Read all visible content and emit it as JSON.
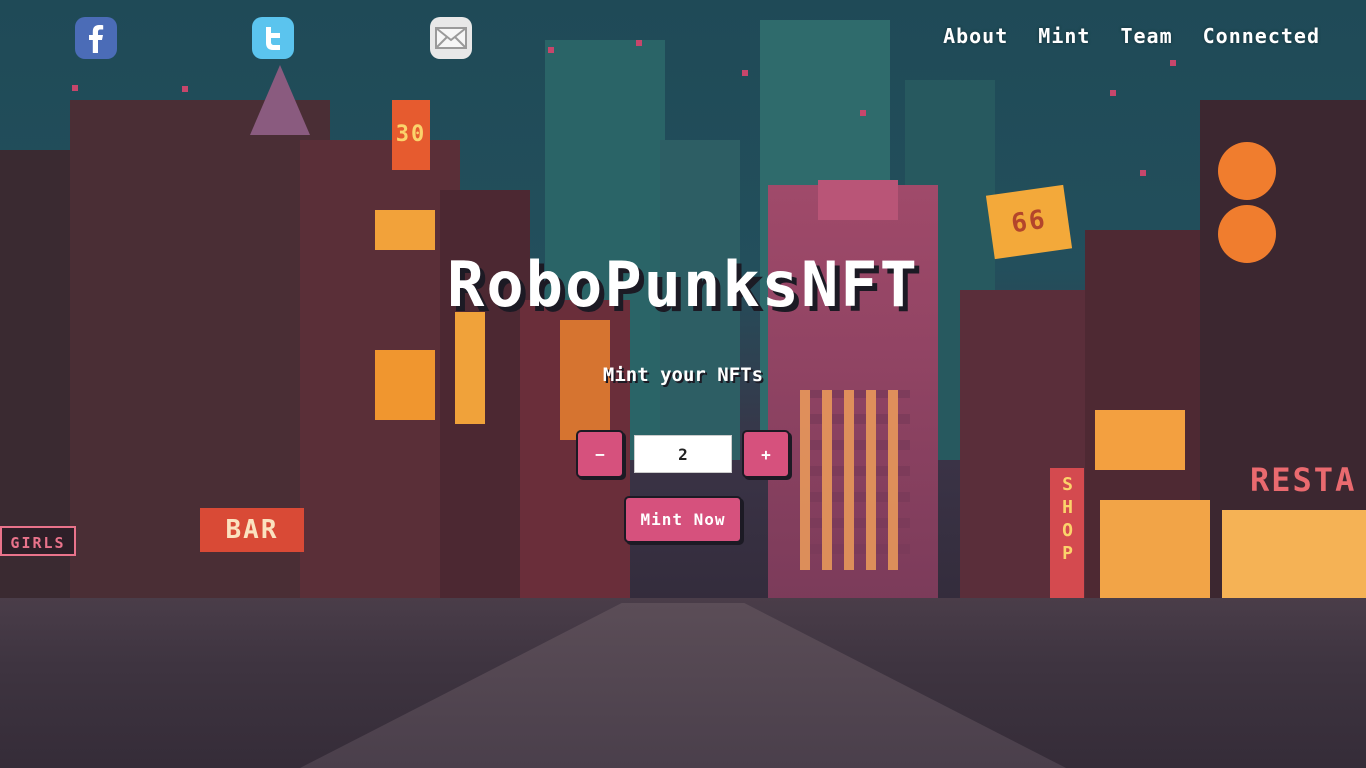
{
  "header": {
    "social": [
      {
        "name": "facebook",
        "icon": "facebook-icon",
        "color": "#4b6cb7"
      },
      {
        "name": "twitter",
        "icon": "twitter-icon",
        "color": "#5bc4ee"
      },
      {
        "name": "email",
        "icon": "email-icon",
        "color": "#e8e8e8"
      }
    ],
    "nav": {
      "about": "About",
      "mint": "Mint",
      "team": "Team",
      "connected": "Connected"
    }
  },
  "hero": {
    "title": "RoboPunksNFT",
    "subtitle": "Mint your NFTs",
    "decrement_label": "−",
    "quantity": "2",
    "increment_label": "+",
    "mint_label": "Mint Now"
  },
  "background_signs": {
    "bar": "BAR",
    "girls": "GIRLS",
    "shop": "SHOP",
    "restaurant": "RESTA",
    "sign_30": "30",
    "sign_66": "66"
  },
  "colors": {
    "accent": "#d6517d",
    "text": "#ffffff",
    "shadow": "#1c1a24"
  }
}
